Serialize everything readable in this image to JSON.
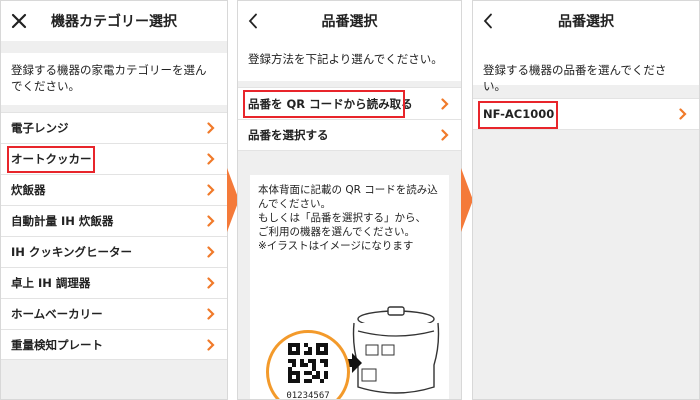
{
  "screen1": {
    "title": "機器カテゴリー選択",
    "intro": "登録する機器の家電カテゴリーを選んでください。",
    "items": [
      {
        "label": "電子レンジ"
      },
      {
        "label": "オートクッカー"
      },
      {
        "label": "炊飯器"
      },
      {
        "label": "自動計量 IH 炊飯器"
      },
      {
        "label": "IH クッキングヒーター"
      },
      {
        "label": "卓上 IH 調理器"
      },
      {
        "label": "ホームベーカリー"
      },
      {
        "label": "重量検知プレート"
      }
    ]
  },
  "screen2": {
    "title": "品番選択",
    "intro": "登録方法を下記より選んでください。",
    "options": [
      {
        "label": "品番を QR コードから読み取る"
      },
      {
        "label": "品番を選択する"
      }
    ],
    "instructions": [
      "本体背面に記載の QR コードを読み込んでください。",
      "もしくは「品番を選択する」から、",
      "ご利用の機器を選んでください。",
      "※イラストはイメージになります"
    ],
    "qr_number": "01234567"
  },
  "screen3": {
    "title": "品番選択",
    "intro": "登録する機器の品番を選んでください。",
    "models": [
      {
        "label": "NF-AC1000"
      }
    ]
  },
  "colors": {
    "chevron": "#f07a2a",
    "highlight": "#e8252b",
    "flow_arrow": "#f47a3a",
    "qr_ring": "#f39a2b"
  }
}
